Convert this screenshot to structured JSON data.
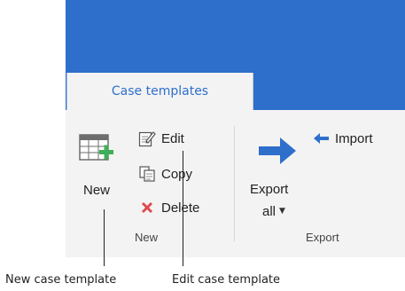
{
  "ribbon": {
    "tab_label": "Case templates",
    "groups": {
      "new": {
        "label": "New",
        "new_button": "New",
        "edit_button": "Edit",
        "copy_button": "Copy",
        "delete_button": "Delete"
      },
      "export": {
        "label": "Export",
        "export_all_line1": "Export",
        "export_all_line2": "all",
        "import_button": "Import"
      }
    }
  },
  "callouts": {
    "new": "New case template",
    "edit": "Edit case template"
  },
  "colors": {
    "accent": "#2e6fcc",
    "delete_red": "#e0474c",
    "add_green": "#3fae5a"
  }
}
